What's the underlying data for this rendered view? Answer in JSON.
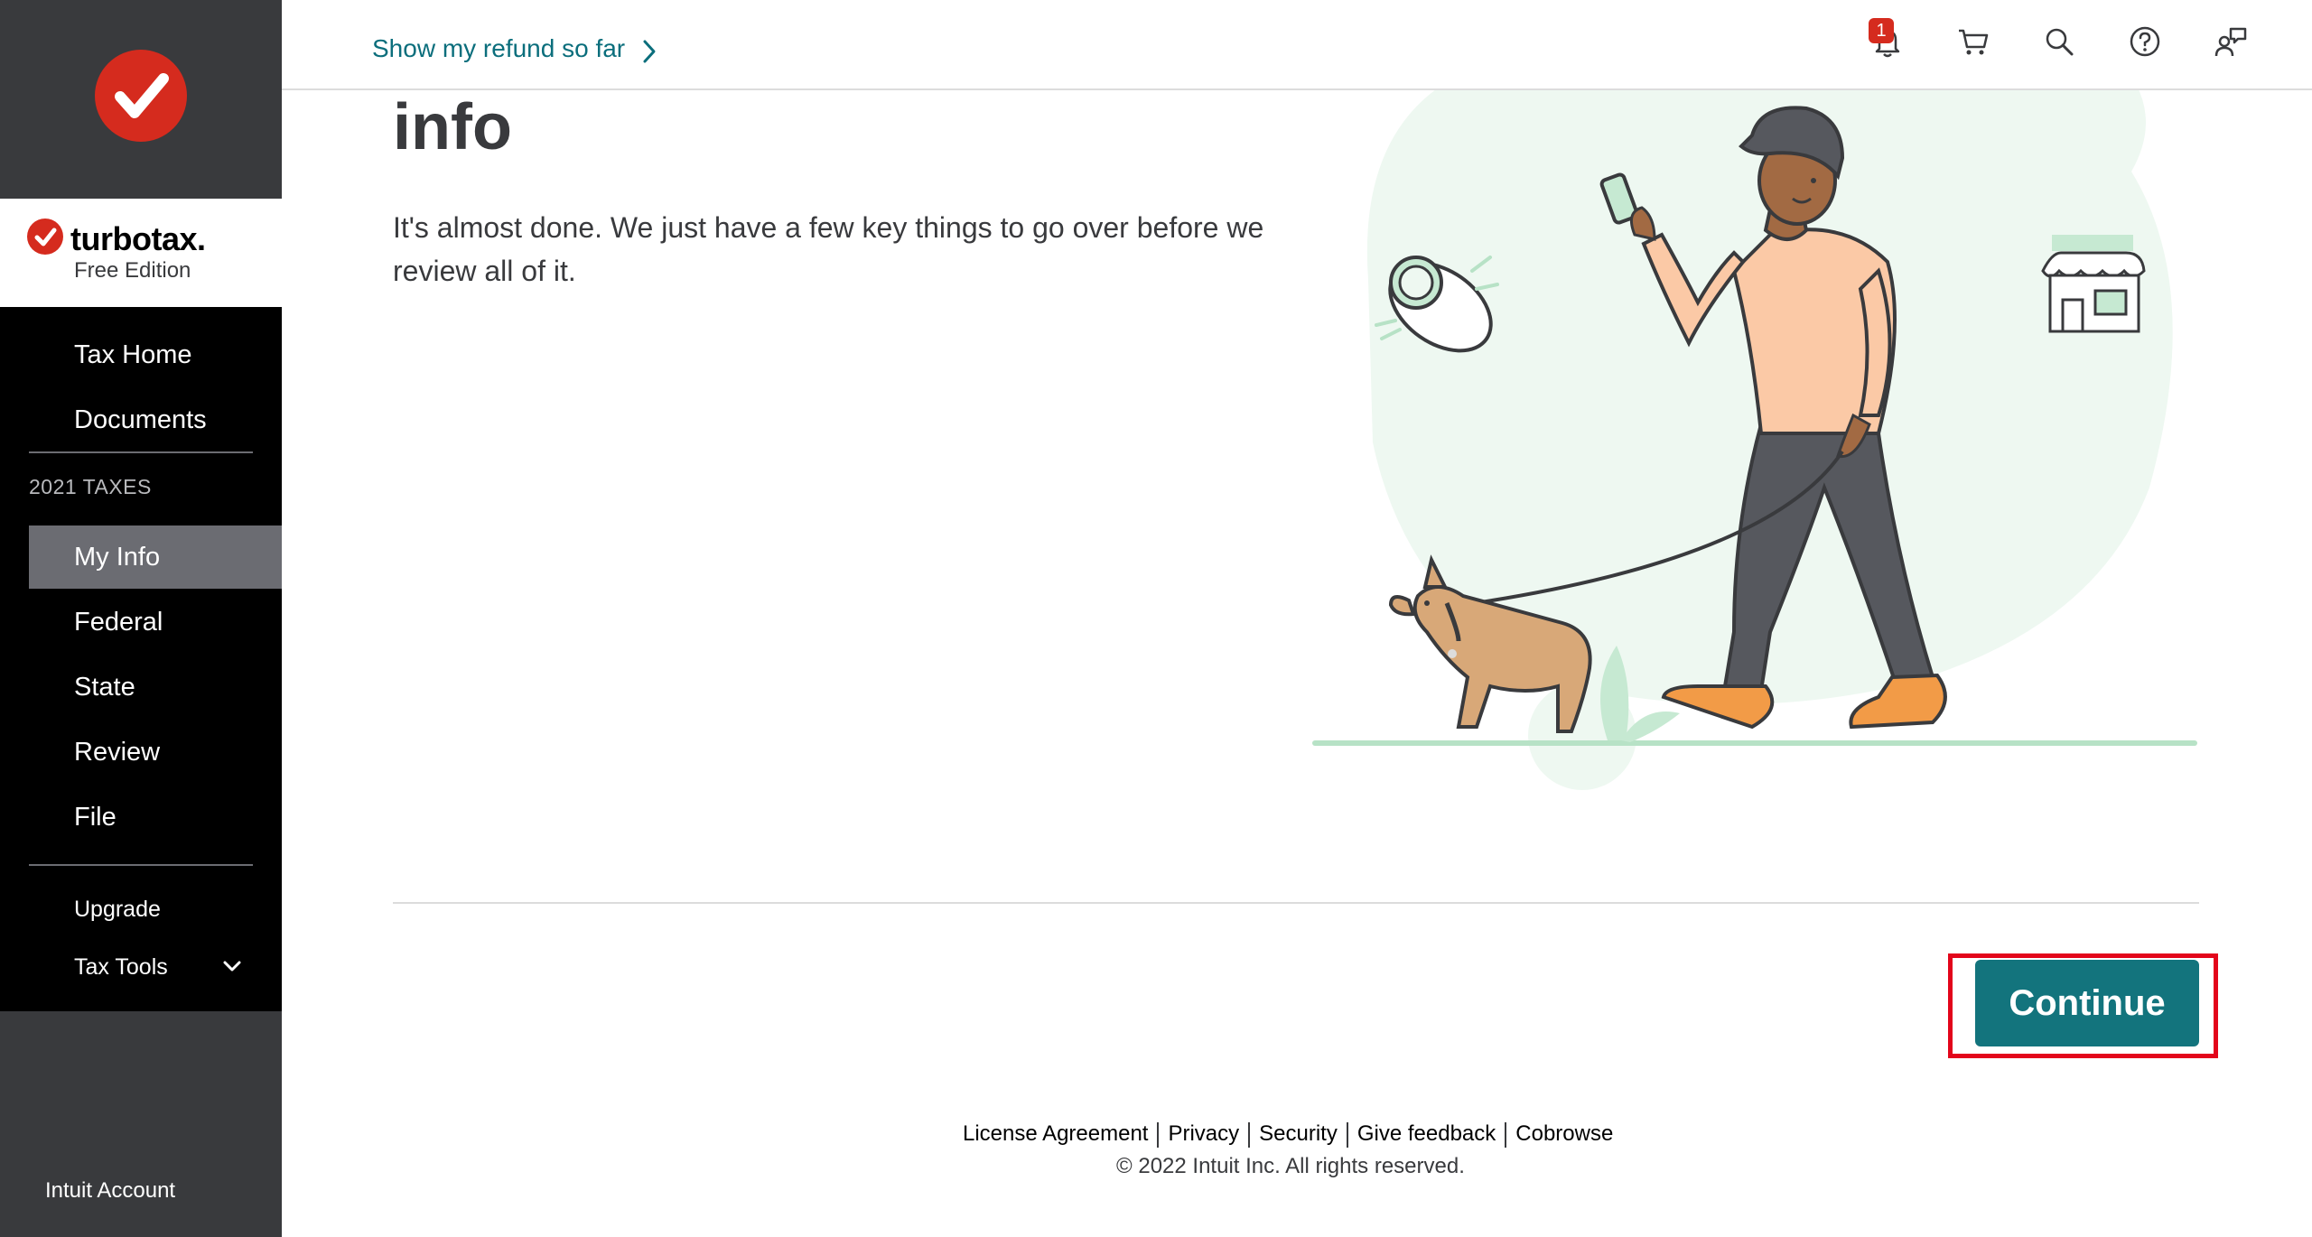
{
  "sidebar": {
    "brand_name": "turbotax.",
    "brand_edition": "Free Edition",
    "items": [
      {
        "label": "Tax Home"
      },
      {
        "label": "Documents"
      },
      {
        "label": "My Info"
      },
      {
        "label": "Federal"
      },
      {
        "label": "State"
      },
      {
        "label": "Review"
      },
      {
        "label": "File"
      },
      {
        "label": "Upgrade"
      },
      {
        "label": "Tax Tools"
      }
    ],
    "section_label": "2021 TAXES",
    "account_label": "Intuit Account"
  },
  "header": {
    "refund_link": "Show my refund so far",
    "notification_count": "1",
    "icons": [
      "bell-icon",
      "cart-icon",
      "search-icon",
      "help-icon",
      "chat-icon"
    ]
  },
  "main": {
    "heading": "info",
    "body": "It's almost done. We just have a few key things to go over before we review all of it.",
    "continue_label": "Continue"
  },
  "footer": {
    "links": [
      "License Agreement",
      "Privacy",
      "Security",
      "Give feedback",
      "Cobrowse"
    ],
    "copyright": "© 2022 Intuit Inc. All rights reserved."
  },
  "colors": {
    "accent": "#13747d",
    "link": "#0b6e7c",
    "brand_red": "#d52b1e",
    "sidebar_dark": "#393a3d"
  }
}
